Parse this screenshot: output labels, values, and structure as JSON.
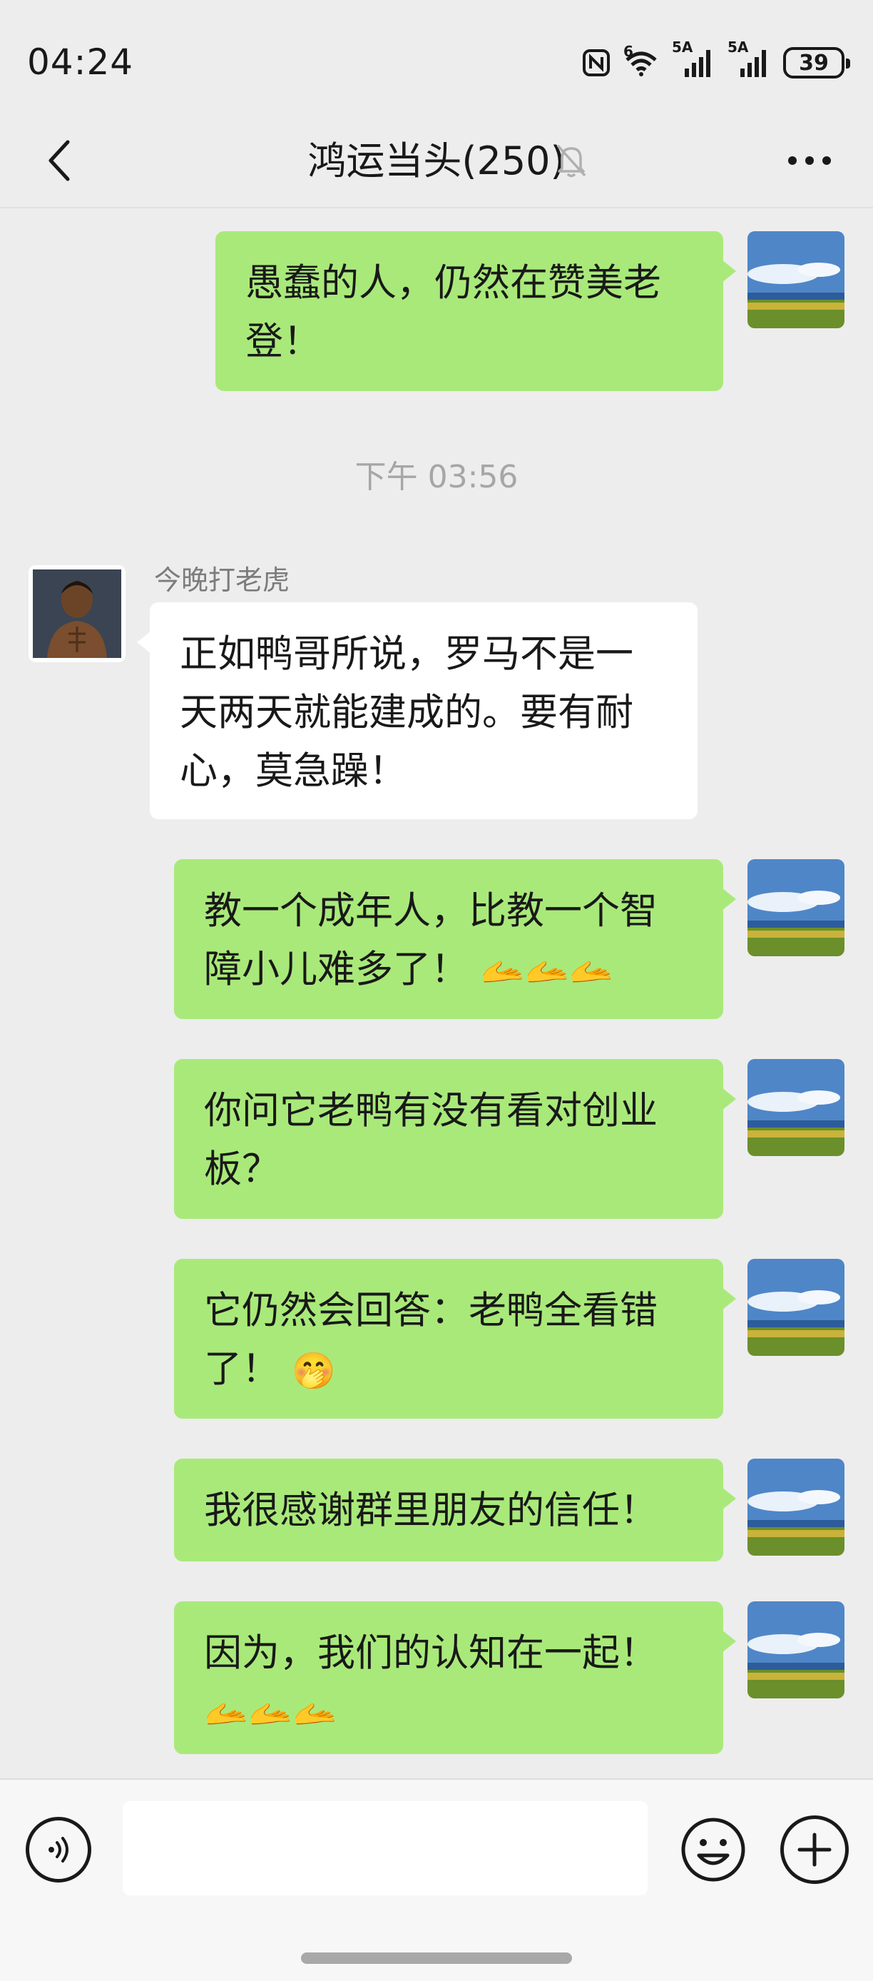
{
  "status_bar": {
    "time": "04:24",
    "signal1_label": "5A",
    "signal2_label": "5A",
    "wifi_label": "6",
    "battery": "39"
  },
  "nav": {
    "title": "鸿运当头(250)",
    "back_icon": "chevron-left-icon",
    "mute_icon": "bell-off-icon",
    "more_icon": "more-dots-icon"
  },
  "messages": {
    "m1": {
      "text": "愚蠢的人，仍然在赞美老登！"
    },
    "timestamp": "下午 03:56",
    "m2": {
      "sender": "今晚打老虎",
      "text": "正如鸭哥所说，罗马不是一天两天就能建成的。要有耐心，莫急躁！"
    },
    "m3": {
      "text": "教一个成年人，比教一个智障小儿难多了！",
      "emoji": "🫴🫴🫴"
    },
    "m4": {
      "text": "你问它老鸭有没有看对创业板？"
    },
    "m5": {
      "text": "它仍然会回答：老鸭全看错了！",
      "emoji": "🤭"
    },
    "m6": {
      "text": "我很感谢群里朋友的信任！"
    },
    "m7": {
      "text": "因为，我们的认知在一起！",
      "emoji": "🫴🫴🫴"
    }
  },
  "input_bar": {
    "placeholder": "",
    "voice_icon": "voice-icon",
    "emoji_icon": "smiley-icon",
    "plus_icon": "plus-icon"
  },
  "colors": {
    "bg": "#ededed",
    "green_bubble": "#a9e97a",
    "white_bubble": "#ffffff",
    "timestamp": "#a6a6a6"
  }
}
